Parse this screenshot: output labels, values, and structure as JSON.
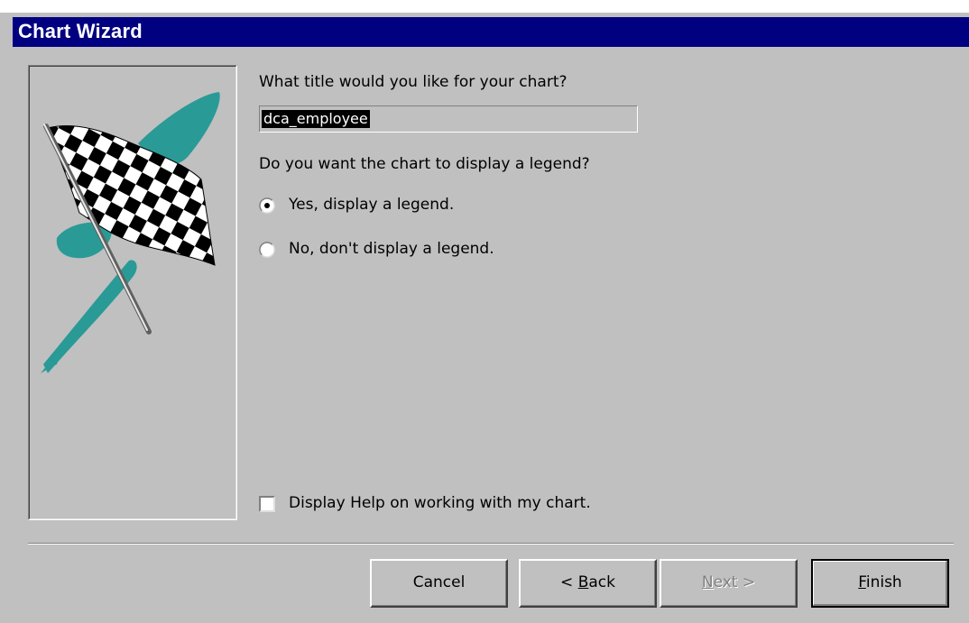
{
  "window": {
    "title": "Chart Wizard"
  },
  "image_panel": {
    "icon": "checkered-flag-icon",
    "accent_color": "#2a9a96"
  },
  "title_question": "What title would you like for your chart?",
  "title_input": {
    "value": "dca_employee"
  },
  "legend_question": "Do you want the chart to display a legend?",
  "legend_options": [
    {
      "label": "Yes, display a legend.",
      "selected": true
    },
    {
      "label": "No, don't display a legend.",
      "selected": false
    }
  ],
  "help_checkbox": {
    "label": "Display Help on working with my chart.",
    "checked": false
  },
  "buttons": {
    "cancel": {
      "label": "Cancel",
      "enabled": true
    },
    "back": {
      "prefix": "< ",
      "mnemonic": "B",
      "rest": "ack",
      "enabled": true
    },
    "next": {
      "mnemonic": "N",
      "rest": "ext >",
      "enabled": false
    },
    "finish": {
      "mnemonic": "F",
      "rest": "inish",
      "enabled": true,
      "default": true
    }
  }
}
